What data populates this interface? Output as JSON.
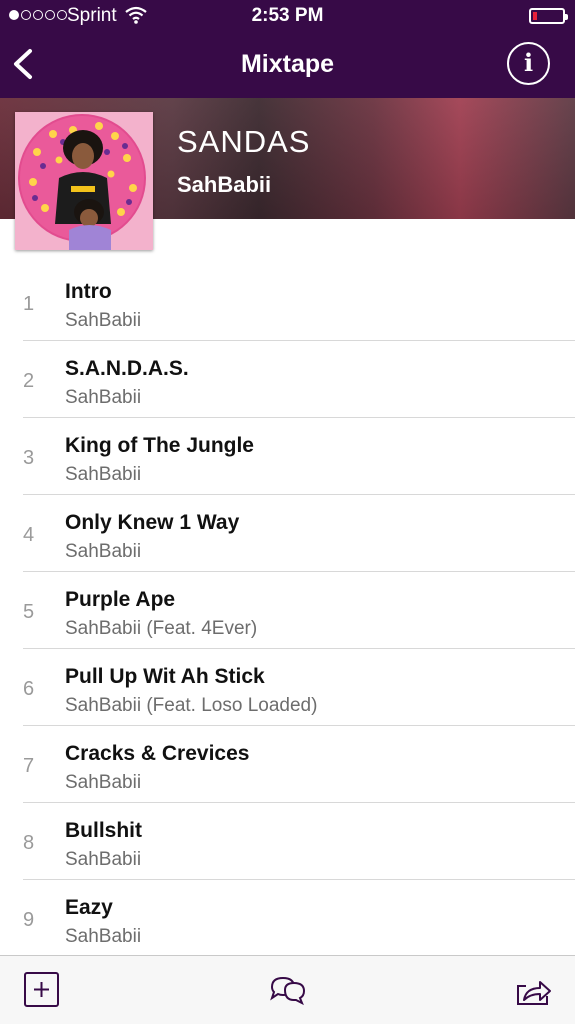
{
  "status_bar": {
    "signal_bars": 1,
    "carrier": "Sprint",
    "time": "2:53 PM",
    "battery_level": 0.1,
    "battery_color": "#e8213a",
    "icons": [
      "wifi-icon",
      "battery-icon"
    ]
  },
  "nav": {
    "title": "Mixtape",
    "back_icon": "chevron-left-icon",
    "info_label": "i",
    "background": "#370a47"
  },
  "mixtape": {
    "title": "SANDAS",
    "artist": "SahBabii"
  },
  "tracks": [
    {
      "number": "1",
      "title": "Intro",
      "artist": "SahBabii"
    },
    {
      "number": "2",
      "title": "S.A.N.D.A.S.",
      "artist": "SahBabii"
    },
    {
      "number": "3",
      "title": "King of The Jungle",
      "artist": "SahBabii"
    },
    {
      "number": "4",
      "title": "Only Knew 1 Way",
      "artist": "SahBabii"
    },
    {
      "number": "5",
      "title": "Purple Ape",
      "artist": "SahBabii (Feat. 4Ever)"
    },
    {
      "number": "6",
      "title": "Pull Up Wit Ah Stick",
      "artist": "SahBabii (Feat. Loso Loaded)"
    },
    {
      "number": "7",
      "title": "Cracks & Crevices",
      "artist": "SahBabii"
    },
    {
      "number": "8",
      "title": "Bullshit",
      "artist": "SahBabii"
    },
    {
      "number": "9",
      "title": "Eazy",
      "artist": "SahBabii"
    }
  ],
  "toolbar": {
    "icons": [
      "add-icon",
      "comments-icon",
      "share-icon"
    ],
    "accent": "#370a47"
  }
}
